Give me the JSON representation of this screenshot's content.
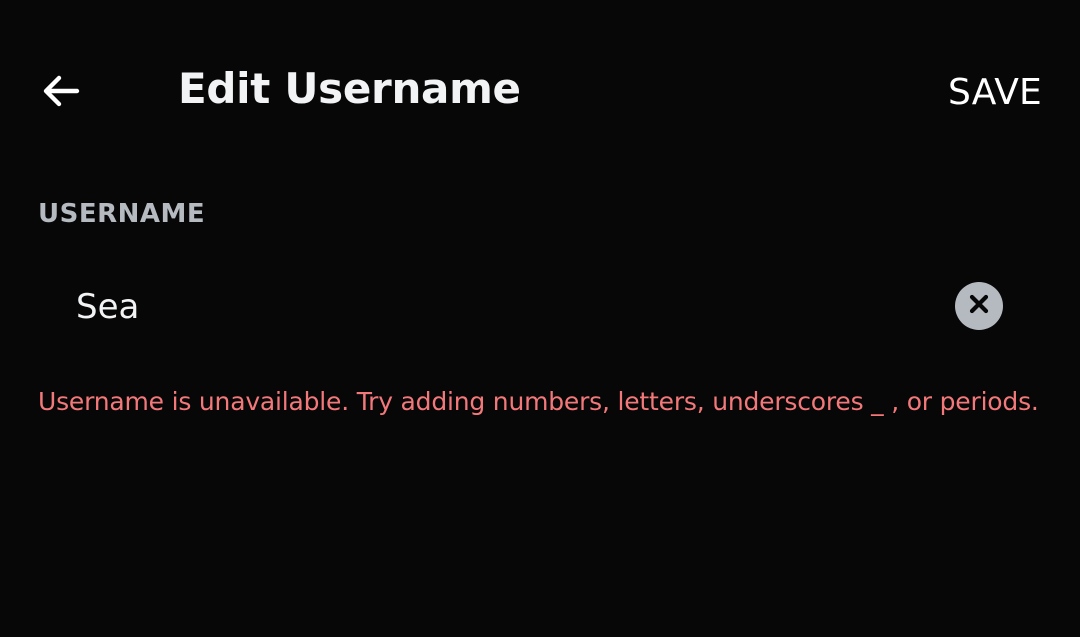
{
  "header": {
    "back_icon": "arrow-left-icon",
    "title": "Edit Username",
    "save_label": "SAVE"
  },
  "form": {
    "section_label": "USERNAME",
    "username_value": "Sea",
    "clear_icon": "close-circle-icon",
    "error_message": "Username is unavailable. Try adding numbers, letters, underscores _ , or periods."
  },
  "colors": {
    "background": "#070708",
    "text_primary": "#f2f3f5",
    "label_muted": "#b5bac1",
    "error": "#f2787a"
  }
}
